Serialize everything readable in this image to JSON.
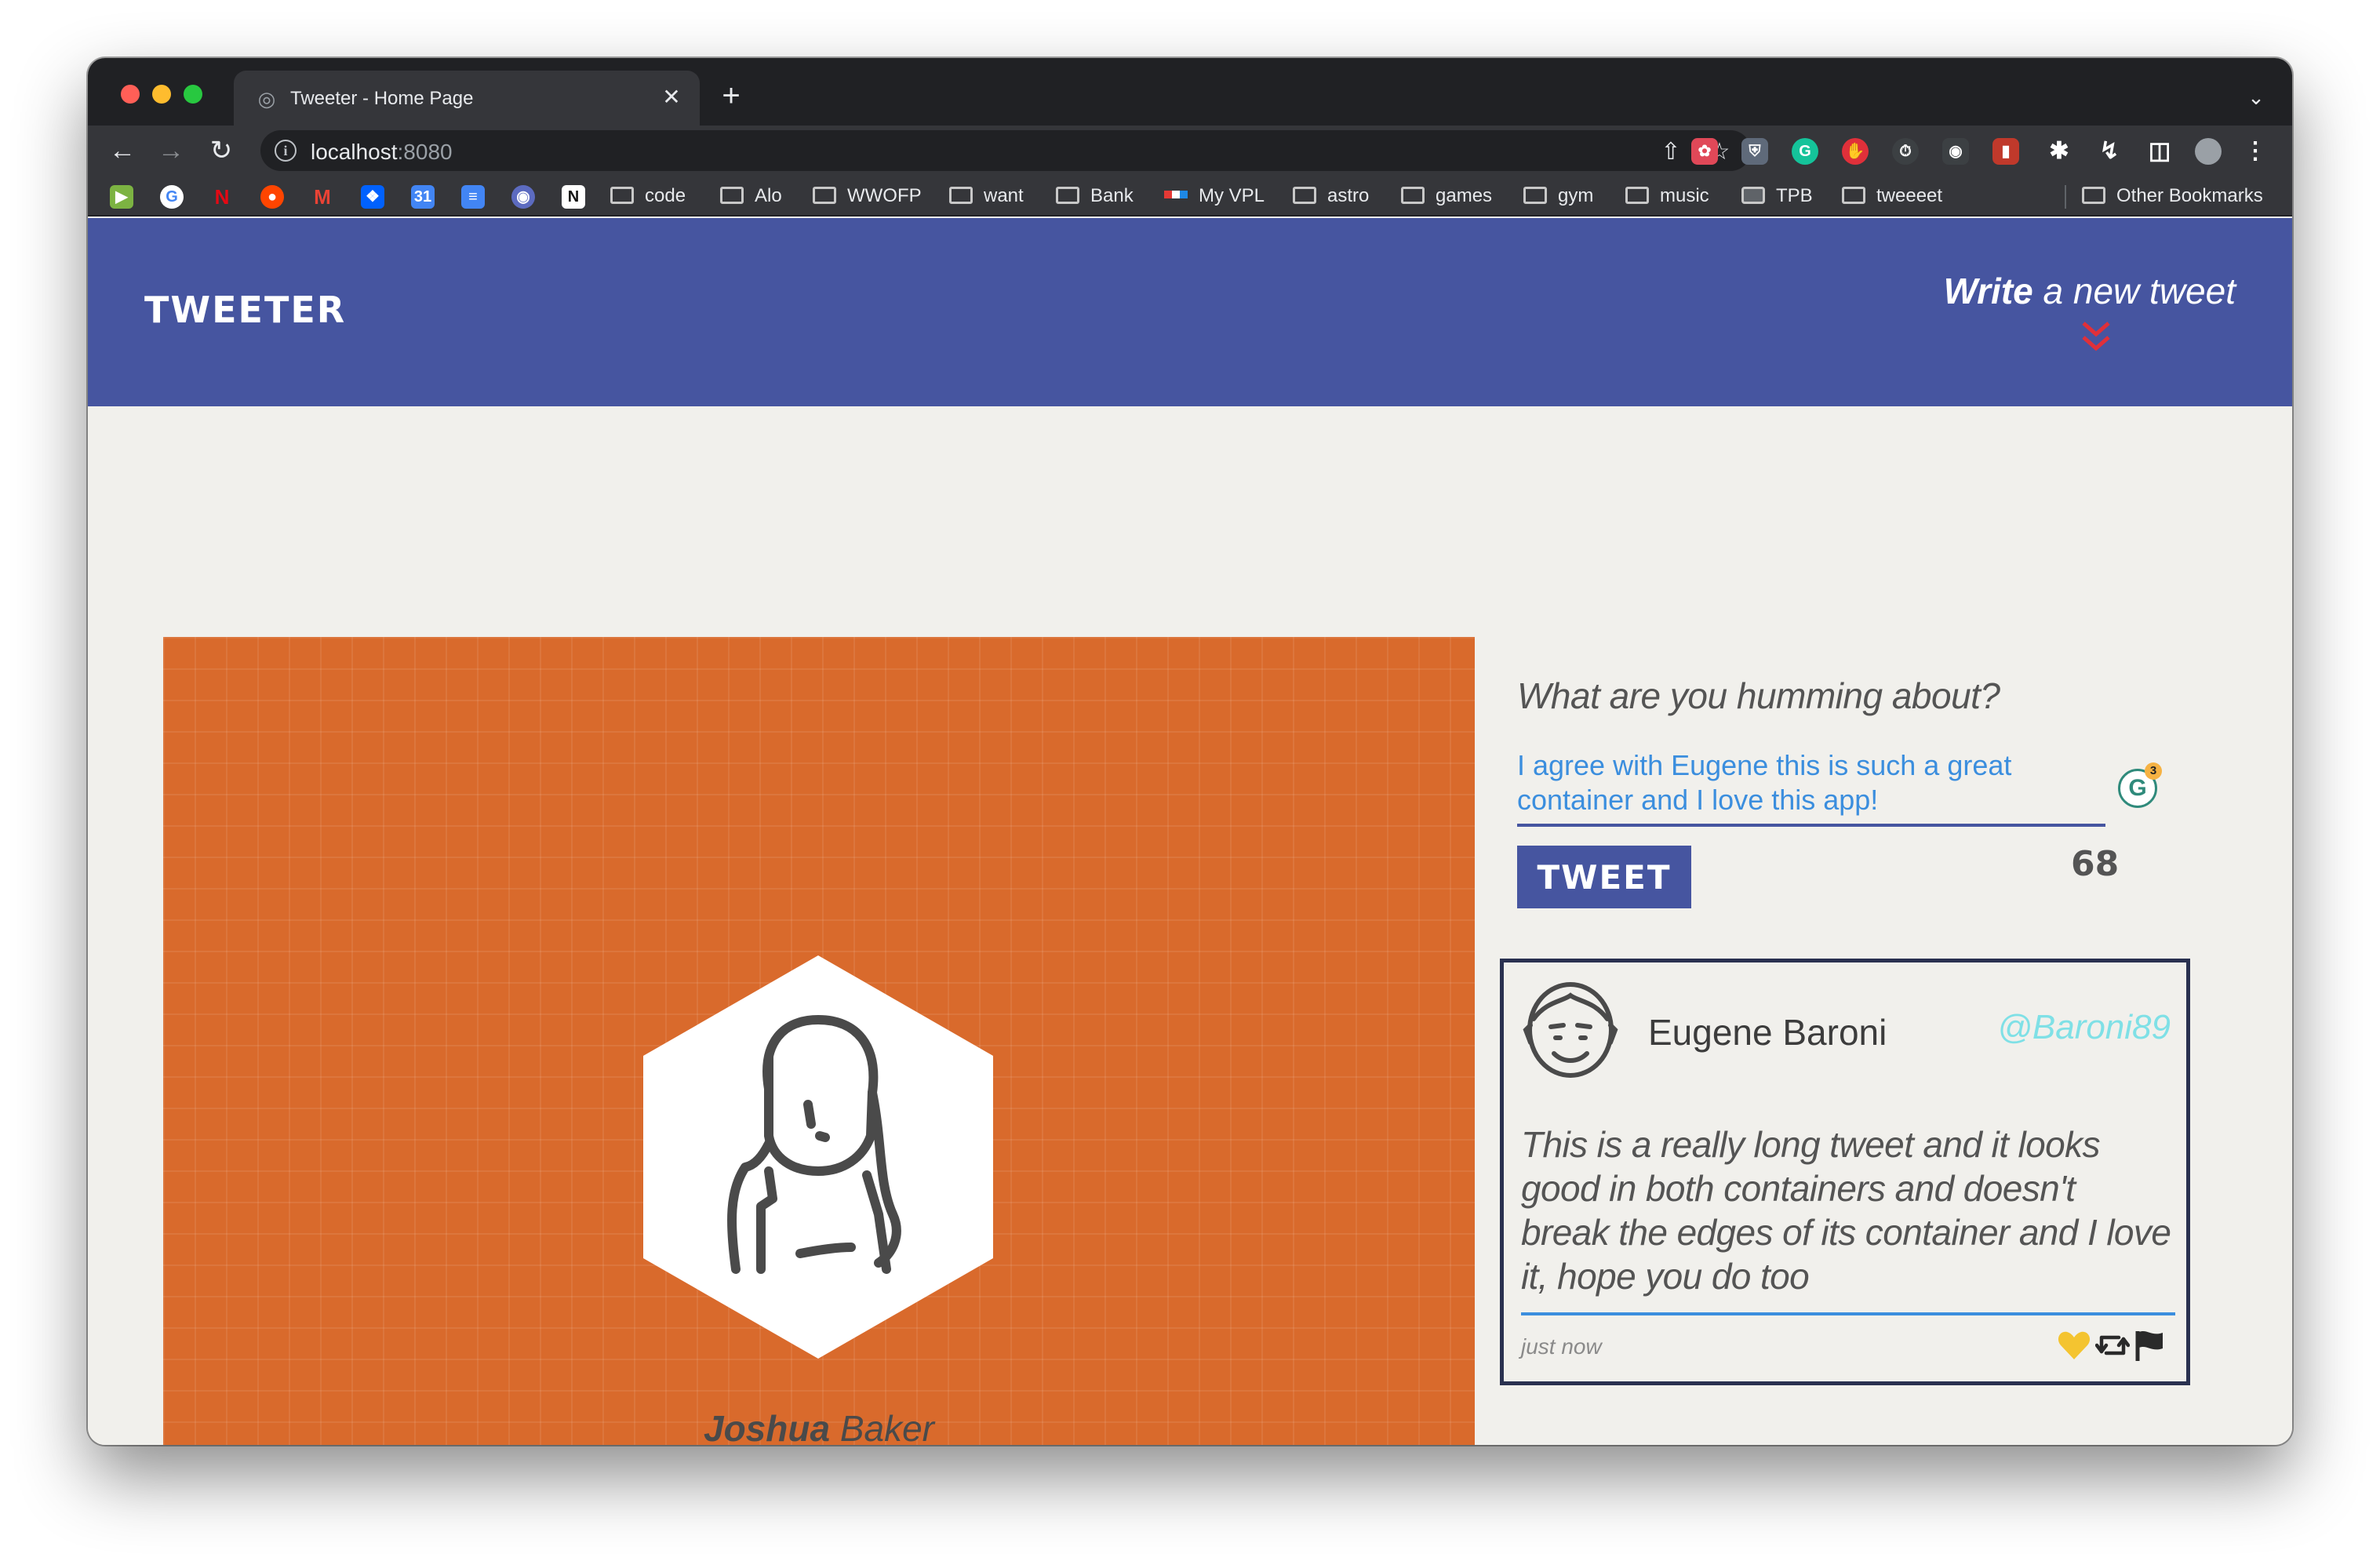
{
  "browser": {
    "tab_title": "Tweeter - Home Page",
    "new_tab": "+",
    "url_host": "localhost",
    "url_port": ":8080",
    "bookmarks": [
      "code",
      "Alo",
      "WWOFP",
      "want",
      "Bank",
      "My VPL",
      "astro",
      "games",
      "gym",
      "music",
      "TPB",
      "tweeeet"
    ],
    "other_bookmarks": "Other Bookmarks"
  },
  "nav": {
    "brand": "TWEETER",
    "write_strong": "Write",
    "write_rest": " a new tweet"
  },
  "profile": {
    "first_name": "Joshua",
    "last_name": " Baker",
    "bg_color": "#d96a2c"
  },
  "composer": {
    "prompt": "What are you humming about?",
    "text": "I agree with Eugene this is such a great container and I love this app!",
    "button": "TWEET",
    "counter": "68",
    "grammarly_count": "3"
  },
  "tweet": {
    "name": "Eugene Baroni",
    "handle": "@Baroni89",
    "body": "This is a really long tweet and it looks good in both containers and doesn't break the edges of its container and I love it, hope you do too",
    "time": "just now"
  },
  "colors": {
    "nav_bg": "#4655a0",
    "accent_red": "#e0303a",
    "link_blue": "#3b8ede",
    "handle_cyan": "#7fe0e6"
  }
}
